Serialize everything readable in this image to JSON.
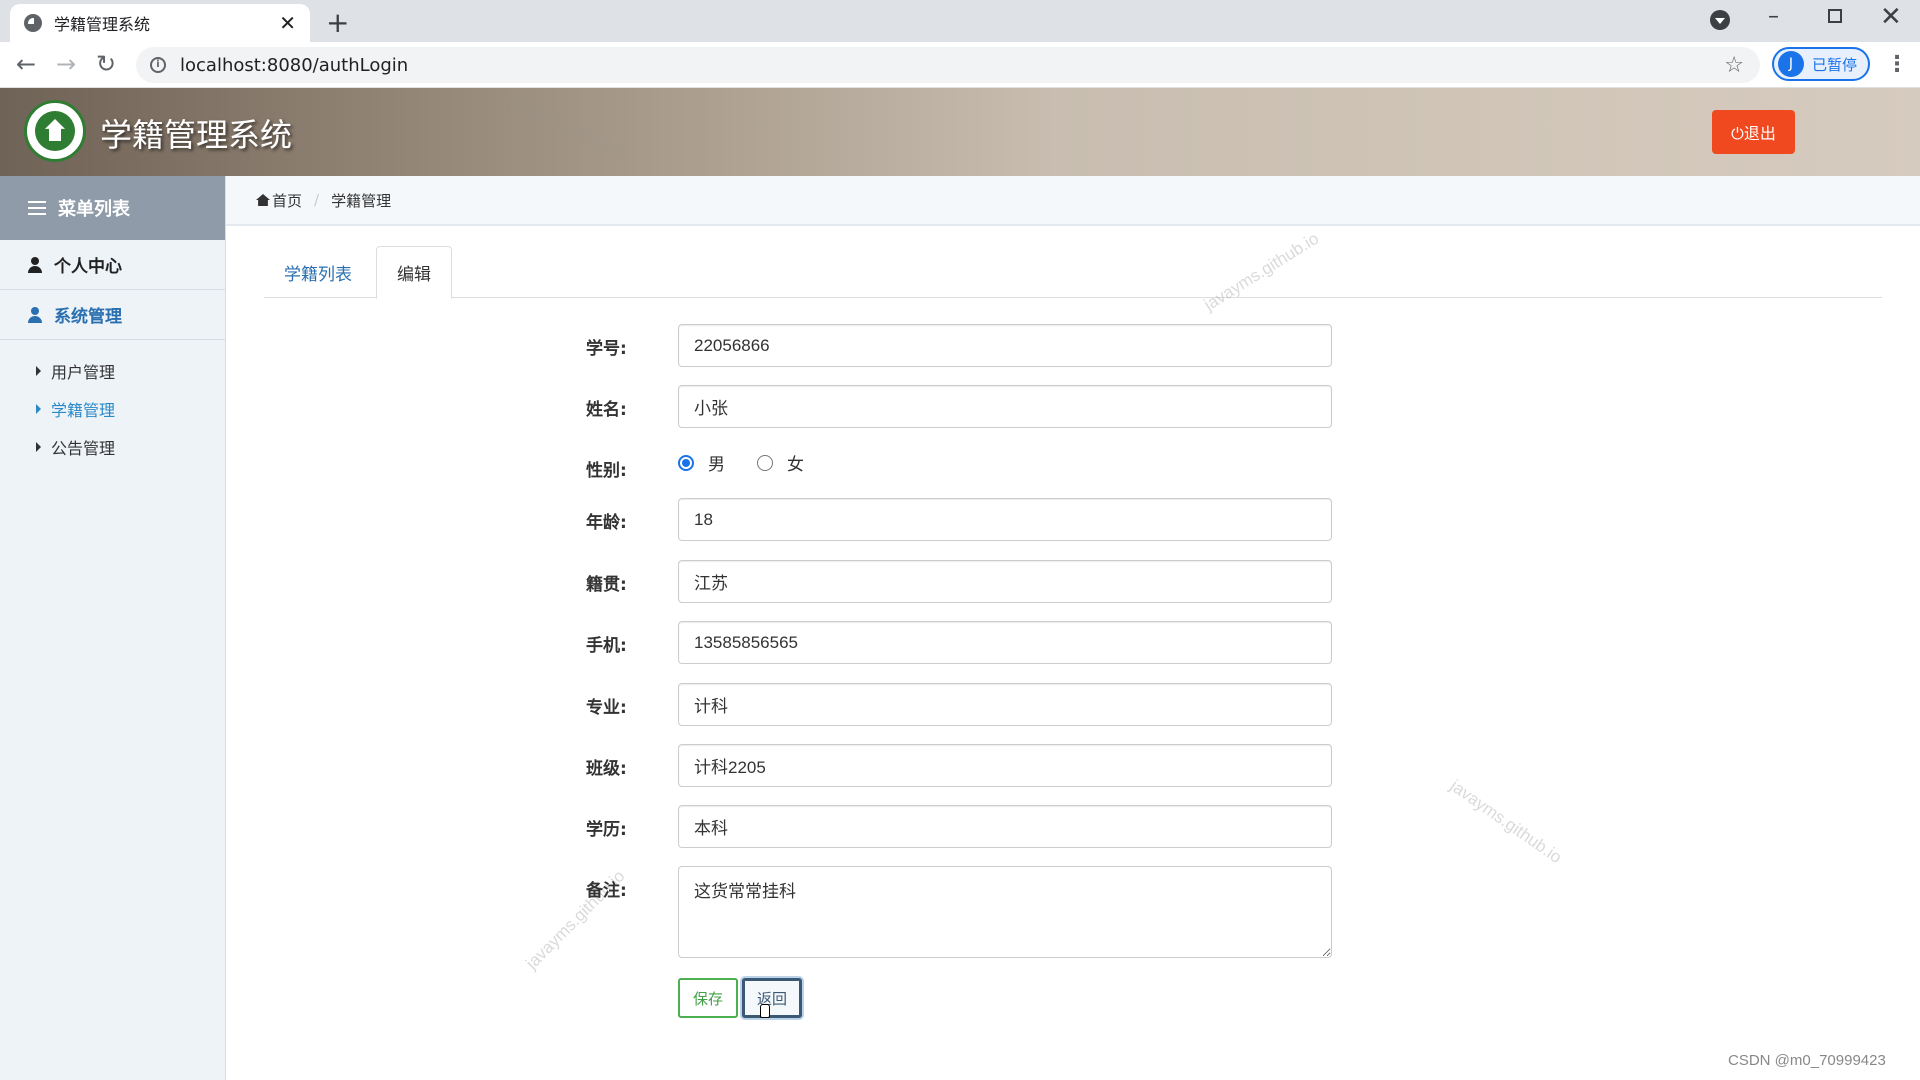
{
  "browser": {
    "tab_title": "学籍管理系统",
    "tab_close": "✕",
    "new_tab": "+",
    "url": "localhost:8080/authLogin",
    "profile_initial": "J",
    "profile_status": "已暂停",
    "back": "←",
    "forward": "→",
    "reload": "↻",
    "star": "☆",
    "menu": "⋮",
    "minimize": "–",
    "close": "✕"
  },
  "header": {
    "title": "学籍管理系统",
    "logout_label": "⏻退出",
    "accent_color": "#f0481f"
  },
  "watermark_text": "javayms.github.io",
  "sidebar": {
    "heading": "菜单列表",
    "sections": [
      {
        "label": "个人中心"
      },
      {
        "label": "系统管理"
      }
    ],
    "items": [
      {
        "label": "用户管理"
      },
      {
        "label": "学籍管理"
      },
      {
        "label": "公告管理"
      }
    ]
  },
  "breadcrumb": {
    "home": "首页",
    "current": "学籍管理"
  },
  "tabs": [
    {
      "label": "学籍列表"
    },
    {
      "label": "编辑"
    }
  ],
  "form": {
    "student_id": {
      "label": "学号:",
      "value": "22056866"
    },
    "name": {
      "label": "姓名:",
      "value": "小张"
    },
    "gender": {
      "label": "性别:",
      "option_male": "男",
      "option_female": "女",
      "selected": "男"
    },
    "age": {
      "label": "年龄:",
      "value": "18"
    },
    "hometown": {
      "label": "籍贯:",
      "value": "江苏"
    },
    "phone": {
      "label": "手机:",
      "value": "13585856565"
    },
    "major": {
      "label": "专业:",
      "value": "计科"
    },
    "class": {
      "label": "班级:",
      "value": "计科2205"
    },
    "education": {
      "label": "学历:",
      "value": "本科"
    },
    "remark": {
      "label": "备注:",
      "value": "这货常常挂科"
    },
    "save_label": "保存",
    "back_label": "返回"
  },
  "credit": "CSDN @m0_70999423"
}
